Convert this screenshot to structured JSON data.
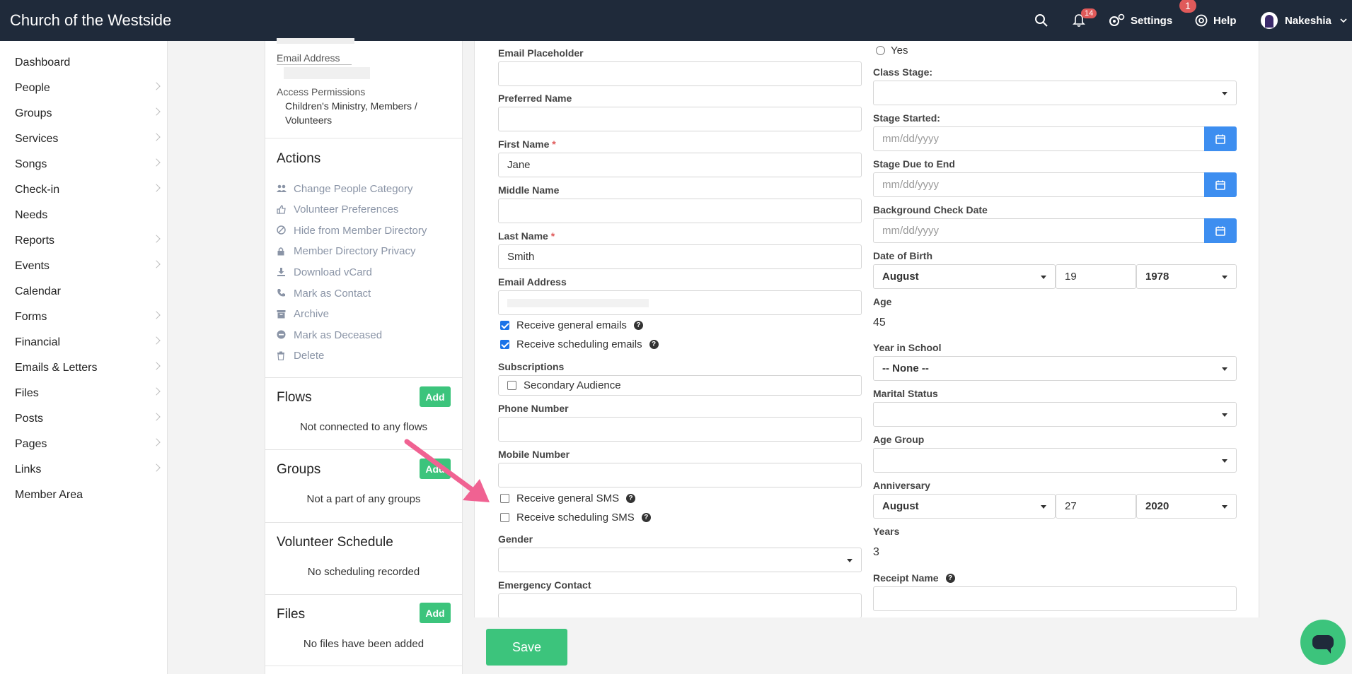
{
  "header": {
    "app_title": "Church of the Westside",
    "notifications_count": "14",
    "settings_label": "Settings",
    "help_label": "Help",
    "help_badge": "1",
    "user_name": "Nakeshia"
  },
  "sidebar": {
    "items": [
      {
        "label": "Dashboard",
        "has_children": false
      },
      {
        "label": "People",
        "has_children": true
      },
      {
        "label": "Groups",
        "has_children": true
      },
      {
        "label": "Services",
        "has_children": true
      },
      {
        "label": "Songs",
        "has_children": true
      },
      {
        "label": "Check-in",
        "has_children": true
      },
      {
        "label": "Needs",
        "has_children": false
      },
      {
        "label": "Reports",
        "has_children": true
      },
      {
        "label": "Events",
        "has_children": true
      },
      {
        "label": "Calendar",
        "has_children": false
      },
      {
        "label": "Forms",
        "has_children": true
      },
      {
        "label": "Financial",
        "has_children": true
      },
      {
        "label": "Emails & Letters",
        "has_children": true
      },
      {
        "label": "Files",
        "has_children": true
      },
      {
        "label": "Posts",
        "has_children": true
      },
      {
        "label": "Pages",
        "has_children": true
      },
      {
        "label": "Links",
        "has_children": true
      },
      {
        "label": "Member Area",
        "has_children": false
      }
    ]
  },
  "profile": {
    "email_label": "Email Address",
    "access_label": "Access Permissions",
    "access_value_line1": "Children's Ministry, Members /",
    "access_value_line2": "Volunteers"
  },
  "actions": {
    "title": "Actions",
    "items": [
      {
        "label": "Change People Category",
        "icon": "users-icon"
      },
      {
        "label": "Volunteer Preferences",
        "icon": "thumbs-up-icon"
      },
      {
        "label": "Hide from Member Directory",
        "icon": "ban-icon"
      },
      {
        "label": "Member Directory Privacy",
        "icon": "lock-icon"
      },
      {
        "label": "Download vCard",
        "icon": "download-icon"
      },
      {
        "label": "Mark as Contact",
        "icon": "phone-icon"
      },
      {
        "label": "Archive",
        "icon": "archive-icon"
      },
      {
        "label": "Mark as Deceased",
        "icon": "minus-circle-icon"
      },
      {
        "label": "Delete",
        "icon": "trash-icon"
      }
    ]
  },
  "flows": {
    "title": "Flows",
    "add_label": "Add",
    "empty": "Not connected to any flows"
  },
  "groups": {
    "title": "Groups",
    "add_label": "Add",
    "empty": "Not a part of any groups"
  },
  "volunteer_schedule": {
    "title": "Volunteer Schedule",
    "empty": "No scheduling recorded"
  },
  "files": {
    "title": "Files",
    "add_label": "Add",
    "empty": "No files have been added"
  },
  "form": {
    "email_placeholder_label": "Email Placeholder",
    "preferred_name_label": "Preferred Name",
    "first_name_label": "First Name",
    "first_name_value": "Jane",
    "required_mark": "*",
    "middle_name_label": "Middle Name",
    "last_name_label": "Last Name",
    "last_name_value": "Smith",
    "email_label": "Email Address",
    "receive_general_emails": "Receive general emails",
    "receive_general_emails_checked": true,
    "receive_scheduling_emails": "Receive scheduling emails",
    "receive_scheduling_emails_checked": true,
    "subscriptions_label": "Subscriptions",
    "secondary_audience": "Secondary Audience",
    "phone_label": "Phone Number",
    "mobile_label": "Mobile Number",
    "receive_general_sms": "Receive general SMS",
    "receive_scheduling_sms": "Receive scheduling SMS",
    "gender_label": "Gender",
    "emergency_label": "Emergency Contact",
    "yes_option": "Yes",
    "class_stage_label": "Class Stage:",
    "stage_started_label": "Stage Started:",
    "stage_due_label": "Stage Due to End",
    "background_check_label": "Background Check Date",
    "date_placeholder": "mm/dd/yyyy",
    "dob_label": "Date of Birth",
    "dob_month": "August",
    "dob_day": "19",
    "dob_year": "1978",
    "age_label": "Age",
    "age_value": "45",
    "year_in_school_label": "Year in School",
    "year_in_school_value": "-- None --",
    "marital_status_label": "Marital Status",
    "age_group_label": "Age Group",
    "anniversary_label": "Anniversary",
    "anniv_month": "August",
    "anniv_day": "27",
    "anniv_year": "2020",
    "years_label": "Years",
    "years_value": "3",
    "receipt_name_label": "Receipt Name"
  },
  "save_label": "Save",
  "colors": {
    "accent_green": "#3cc47c",
    "calendar_blue": "#3d8ef0",
    "topbar": "#1f2a3a",
    "annotation_pink": "#f06292"
  }
}
